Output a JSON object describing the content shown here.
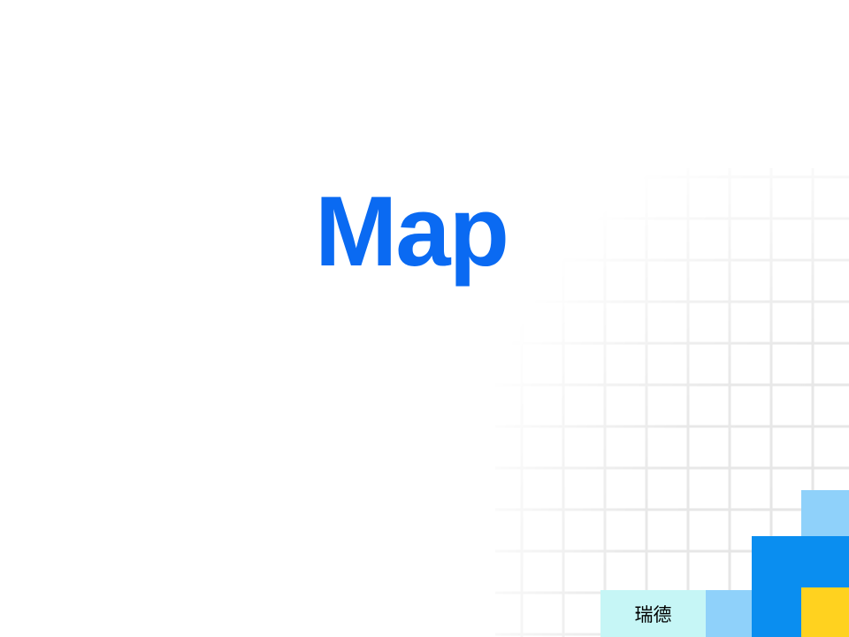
{
  "slide": {
    "title": "Map",
    "footer_label": "瑞德"
  },
  "colors": {
    "title": "#0a6af2",
    "grid_line": "#e4e4e4",
    "block_light_blue": "#8fd1fa",
    "block_blue": "#0a8ef0",
    "block_yellow": "#ffd21f",
    "block_cyan": "#c6f6f6"
  }
}
